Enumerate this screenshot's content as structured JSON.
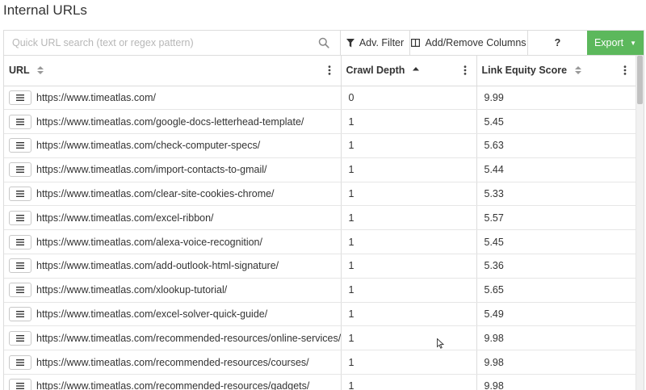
{
  "page": {
    "title": "Internal URLs"
  },
  "toolbar": {
    "search_placeholder": "Quick URL search (text or regex pattern)",
    "filter_label": "Adv. Filter",
    "columns_label": "Add/Remove Columns",
    "help_label": "?",
    "export_label": "Export",
    "export_color": "#5cb85c"
  },
  "table": {
    "columns": [
      {
        "label": "URL",
        "sort": "none"
      },
      {
        "label": "Crawl Depth",
        "sort": "ascending"
      },
      {
        "label": "Link Equity Score",
        "sort": "none"
      }
    ],
    "rows": [
      {
        "url": "https://www.timeatlas.com/",
        "depth": "0",
        "score": "9.99"
      },
      {
        "url": "https://www.timeatlas.com/google-docs-letterhead-template/",
        "depth": "1",
        "score": "5.45"
      },
      {
        "url": "https://www.timeatlas.com/check-computer-specs/",
        "depth": "1",
        "score": "5.63"
      },
      {
        "url": "https://www.timeatlas.com/import-contacts-to-gmail/",
        "depth": "1",
        "score": "5.44"
      },
      {
        "url": "https://www.timeatlas.com/clear-site-cookies-chrome/",
        "depth": "1",
        "score": "5.33"
      },
      {
        "url": "https://www.timeatlas.com/excel-ribbon/",
        "depth": "1",
        "score": "5.57"
      },
      {
        "url": "https://www.timeatlas.com/alexa-voice-recognition/",
        "depth": "1",
        "score": "5.45"
      },
      {
        "url": "https://www.timeatlas.com/add-outlook-html-signature/",
        "depth": "1",
        "score": "5.36"
      },
      {
        "url": "https://www.timeatlas.com/xlookup-tutorial/",
        "depth": "1",
        "score": "5.65"
      },
      {
        "url": "https://www.timeatlas.com/excel-solver-quick-guide/",
        "depth": "1",
        "score": "5.49"
      },
      {
        "url": "https://www.timeatlas.com/recommended-resources/online-services/",
        "depth": "1",
        "score": "9.98"
      },
      {
        "url": "https://www.timeatlas.com/recommended-resources/courses/",
        "depth": "1",
        "score": "9.98"
      },
      {
        "url": "https://www.timeatlas.com/recommended-resources/gadgets/",
        "depth": "1",
        "score": "9.98"
      }
    ]
  }
}
